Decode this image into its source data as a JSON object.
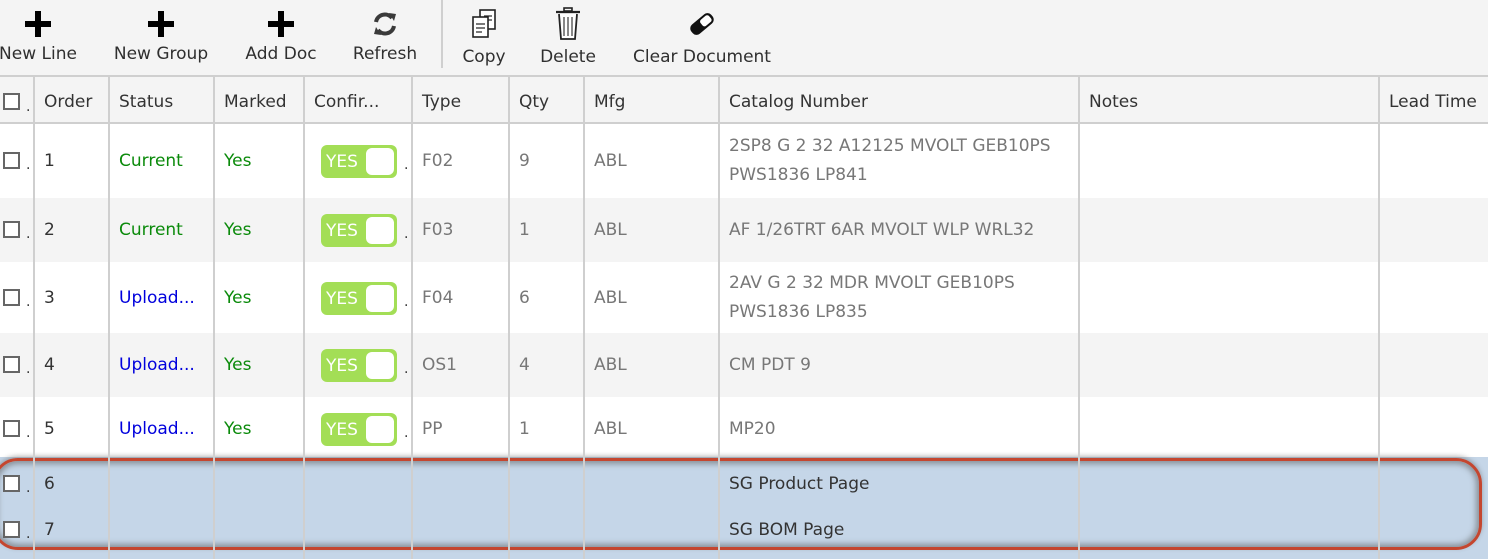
{
  "toolbar": {
    "buttons": [
      {
        "label": "New Line",
        "icon": "plus-icon"
      },
      {
        "label": "New Group",
        "icon": "plus-icon"
      },
      {
        "label": "Add Doc",
        "icon": "plus-icon"
      },
      {
        "label": "Refresh",
        "icon": "refresh-icon"
      },
      {
        "label": "Copy",
        "icon": "copy-icon"
      },
      {
        "label": "Delete",
        "icon": "trash-icon"
      },
      {
        "label": "Clear Document",
        "icon": "eraser-icon"
      }
    ]
  },
  "grid": {
    "columns": [
      "Order",
      "Status",
      "Marked",
      "Confir...",
      "Type",
      "Qty",
      "Mfg",
      "Catalog Number",
      "Notes",
      "Lead Time"
    ],
    "rows": [
      {
        "order": "1",
        "status": "Current",
        "status_kind": "current",
        "marked": "Yes",
        "confirmed": "YES",
        "type": "F02",
        "qty": "9",
        "mfg": "ABL",
        "catalog": "2SP8 G 2 32 A12125 MVOLT GEB10PS PWS1836 LP841",
        "notes": "",
        "lead_time": ""
      },
      {
        "order": "2",
        "status": "Current",
        "status_kind": "current",
        "marked": "Yes",
        "confirmed": "YES",
        "type": "F03",
        "qty": "1",
        "mfg": "ABL",
        "catalog": "AF 1/26TRT 6AR MVOLT WLP WRL32",
        "notes": "",
        "lead_time": ""
      },
      {
        "order": "3",
        "status": "Upload...",
        "status_kind": "upload",
        "marked": "Yes",
        "confirmed": "YES",
        "type": "F04",
        "qty": "6",
        "mfg": "ABL",
        "catalog": "2AV G 2 32 MDR MVOLT GEB10PS PWS1836 LP835",
        "notes": "",
        "lead_time": ""
      },
      {
        "order": "4",
        "status": "Upload...",
        "status_kind": "upload",
        "marked": "Yes",
        "confirmed": "YES",
        "type": "OS1",
        "qty": "4",
        "mfg": "ABL",
        "catalog": "CM PDT 9",
        "notes": "",
        "lead_time": ""
      },
      {
        "order": "5",
        "status": "Upload...",
        "status_kind": "upload",
        "marked": "Yes",
        "confirmed": "YES",
        "type": "PP",
        "qty": "1",
        "mfg": "ABL",
        "catalog": "MP20",
        "notes": "",
        "lead_time": ""
      },
      {
        "order": "6",
        "status": "",
        "marked": "",
        "confirmed": "",
        "type": "",
        "qty": "",
        "mfg": "",
        "catalog": "SG Product Page",
        "notes": "",
        "lead_time": "",
        "highlighted": true
      },
      {
        "order": "7",
        "status": "",
        "marked": "",
        "confirmed": "",
        "type": "",
        "qty": "",
        "mfg": "",
        "catalog": "SG BOM Page",
        "notes": "",
        "lead_time": "",
        "highlighted": true
      }
    ]
  },
  "colors": {
    "status_current": "#0a8a0a",
    "status_upload": "#0000dd",
    "toggle_on": "#a3de56",
    "highlight_bg": "#c5d6e8",
    "highlight_ring": "#c4462f"
  }
}
